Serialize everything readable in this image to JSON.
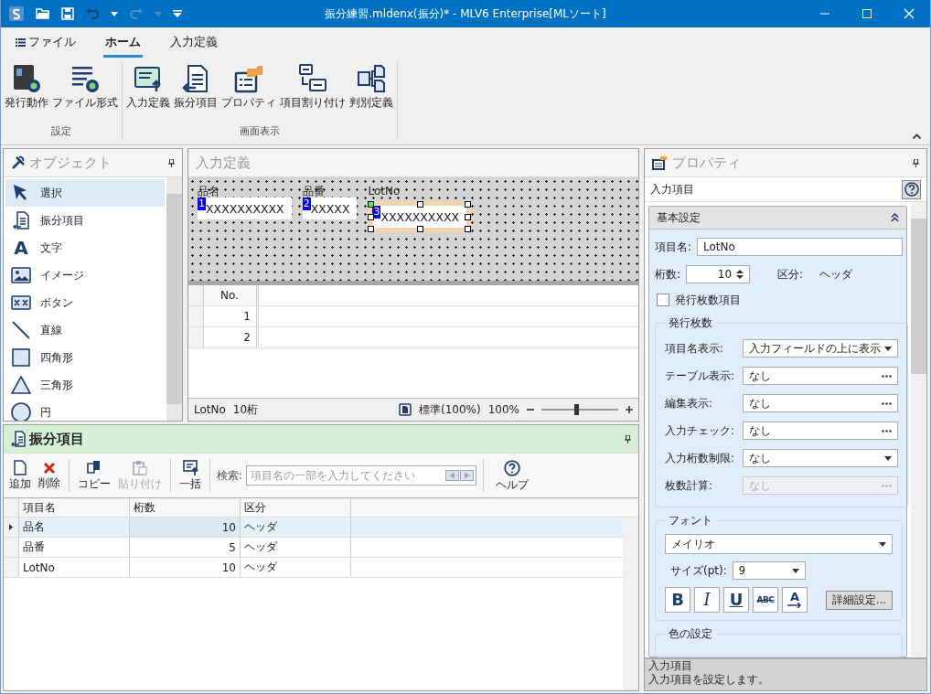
{
  "window": {
    "title": "振分練習.mldenx(振分)* - MLV6 Enterprise[MLソート]"
  },
  "ribbon": {
    "tabs": [
      {
        "label": "ファイル",
        "kind": "menu",
        "selected": false
      },
      {
        "label": "ホーム",
        "kind": "tab",
        "selected": true
      },
      {
        "label": "入力定義",
        "kind": "tab",
        "selected": false
      }
    ],
    "groups": [
      {
        "label": "設定",
        "buttons": [
          {
            "label": "発行動作",
            "kind": "issue"
          },
          {
            "label": "ファイル形式",
            "kind": "format"
          }
        ]
      },
      {
        "label": "画面表示",
        "buttons": [
          {
            "label": "入力定義",
            "kind": "input"
          },
          {
            "label": "振分項目",
            "kind": "sort"
          },
          {
            "label": "プロパティ",
            "kind": "property"
          },
          {
            "label": "項目割り付け",
            "kind": "assign"
          },
          {
            "label": "判別定義",
            "kind": "judge"
          }
        ]
      }
    ]
  },
  "objects": {
    "title": "オブジェクト",
    "items": [
      {
        "label": "選択",
        "kind": "select",
        "selected": true
      },
      {
        "label": "振分項目",
        "kind": "sort",
        "selected": false
      },
      {
        "label": "文字",
        "kind": "text",
        "glyph": "A",
        "selected": false
      },
      {
        "label": "イメージ",
        "kind": "image",
        "selected": false
      },
      {
        "label": "ボタン",
        "kind": "button",
        "selected": false
      },
      {
        "label": "直線",
        "kind": "line",
        "selected": false
      },
      {
        "label": "四角形",
        "kind": "rect",
        "selected": false
      },
      {
        "label": "三角形",
        "kind": "triangle",
        "selected": false
      },
      {
        "label": "円",
        "kind": "circle",
        "selected": false
      }
    ]
  },
  "input_definition": {
    "title": "入力定義",
    "fields": [
      {
        "label": "品名",
        "number": "1",
        "value": "XXXXXXXXXX",
        "selected": false
      },
      {
        "label": "品番",
        "number": "2",
        "value": "XXXXX",
        "selected": false
      },
      {
        "label": "LotNo",
        "number": "3",
        "value": "XXXXXXXXXX",
        "selected": true
      }
    ],
    "table": {
      "columns": [
        "No."
      ],
      "rows": [
        "1",
        "2"
      ]
    },
    "status": {
      "item": "LotNo",
      "digits": "10桁",
      "view": "標準(100%)",
      "zoom": "100%",
      "zoom_slider": {
        "level": 0.45
      }
    }
  },
  "sort_items": {
    "title": "振分項目",
    "toolbar": [
      {
        "label": "追加",
        "kind": "add",
        "disabled": false
      },
      {
        "label": "削除",
        "kind": "delete",
        "disabled": false
      },
      {
        "label": "コピー",
        "kind": "copy",
        "disabled": false
      },
      {
        "label": "貼り付け",
        "kind": "paste",
        "disabled": true
      },
      {
        "label": "一括",
        "kind": "batch",
        "disabled": false
      }
    ],
    "search": {
      "label": "検索:",
      "placeholder": "項目名の一部を入力してください"
    },
    "help": "ヘルプ",
    "columns": [
      "項目名",
      "桁数",
      "区分"
    ],
    "rows": [
      {
        "cells": [
          "品名",
          "10",
          "ヘッダ"
        ],
        "selected": true
      },
      {
        "cells": [
          "品番",
          "5",
          "ヘッダ"
        ],
        "selected": false
      },
      {
        "cells": [
          "LotNo",
          "10",
          "ヘッダ"
        ],
        "selected": false
      }
    ]
  },
  "properties": {
    "title": "プロパティ",
    "subtitle": "入力項目",
    "section": {
      "title": "基本設定",
      "expanded": true
    },
    "name_label": "項目名:",
    "name_value": "LotNo",
    "digits_label": "桁数:",
    "digits_value": "10",
    "category_label": "区分:",
    "category_value": "ヘッダ",
    "issue_count_item": {
      "label": "発行枚数項目",
      "checked": false
    },
    "issue_group": {
      "title": "発行枚数",
      "rows": [
        {
          "label": "項目名表示:",
          "value": "入力フィールドの上に表示",
          "kind": "dropdown",
          "disabled": false
        },
        {
          "label": "テーブル表示:",
          "value": "なし",
          "kind": "ellipsis",
          "disabled": false
        },
        {
          "label": "編集表示:",
          "value": "なし",
          "kind": "ellipsis",
          "disabled": false
        },
        {
          "label": "入力チェック:",
          "value": "なし",
          "kind": "ellipsis",
          "disabled": false
        },
        {
          "label": "入力桁数制限:",
          "value": "なし",
          "kind": "dropdown",
          "disabled": false
        },
        {
          "label": "枚数計算:",
          "value": "なし",
          "kind": "ellipsis",
          "disabled": true
        }
      ]
    },
    "font_group": {
      "title": "フォント",
      "font": "メイリオ",
      "size_label": "サイズ(pt):",
      "size": "9",
      "styles": [
        {
          "label": "B",
          "kind": "bold"
        },
        {
          "label": "I",
          "kind": "italic"
        },
        {
          "label": "U",
          "kind": "underline"
        },
        {
          "label": "ABC",
          "kind": "strike"
        },
        {
          "label": "A",
          "kind": "direction"
        }
      ],
      "detail_button": "詳細設定..."
    },
    "color_group": {
      "title": "色の設定"
    },
    "description": {
      "title": "入力項目",
      "text": "入力項目を設定します。"
    }
  }
}
